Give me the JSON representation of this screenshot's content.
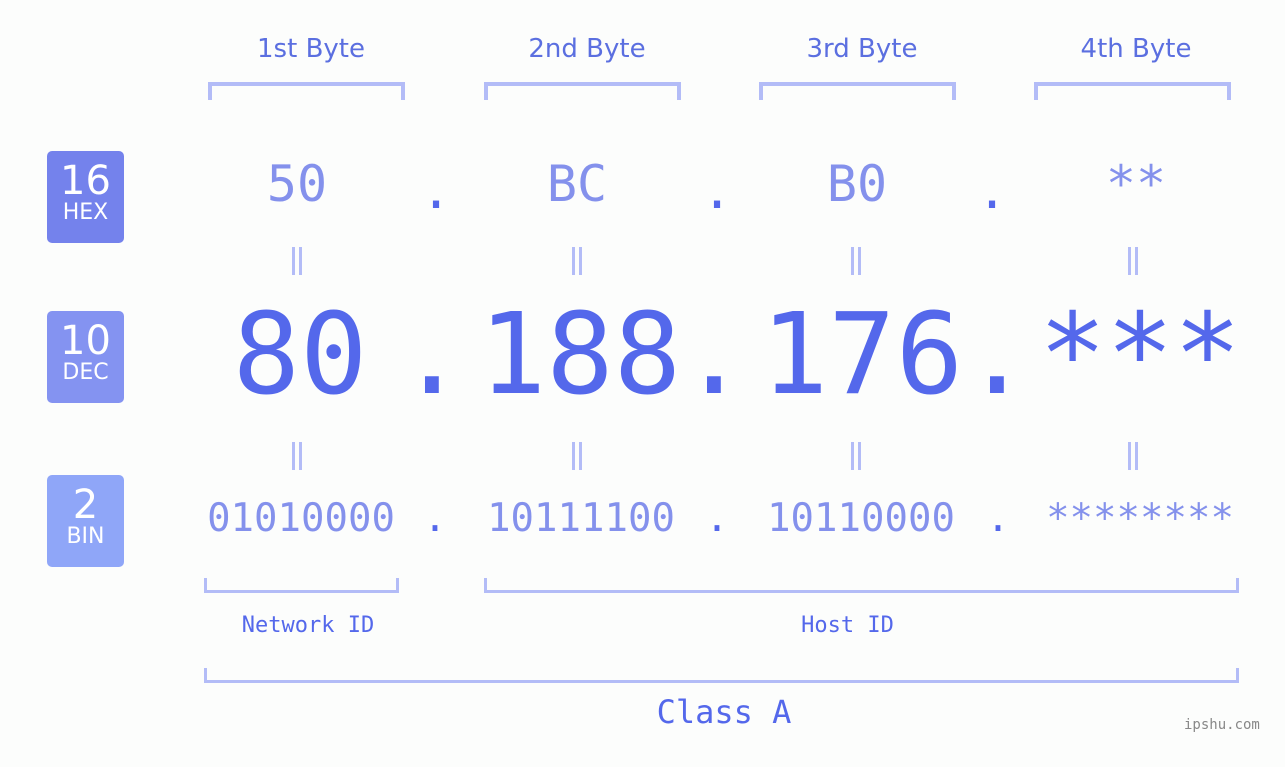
{
  "bytes": {
    "headers": [
      "1st Byte",
      "2nd Byte",
      "3rd Byte",
      "4th Byte"
    ]
  },
  "badges": {
    "hex": {
      "base": "16",
      "label": "HEX",
      "color": "#7482ec"
    },
    "dec": {
      "base": "10",
      "label": "DEC",
      "color": "#8493f1"
    },
    "bin": {
      "base": "2",
      "label": "BIN",
      "color": "#8fa6f8"
    }
  },
  "ip": {
    "hex": [
      "50",
      "BC",
      "B0",
      "**"
    ],
    "dec": [
      "80",
      "188",
      "176",
      "***"
    ],
    "bin": [
      "01010000",
      "10111100",
      "10110000",
      "********"
    ],
    "separator": "."
  },
  "segments": {
    "network_label": "Network ID",
    "host_label": "Host ID",
    "class_label": "Class A"
  },
  "watermark": "ipshu.com",
  "colors": {
    "accent": "#5468eb",
    "light": "#8491ec",
    "bracket": "#b3bcf7"
  }
}
